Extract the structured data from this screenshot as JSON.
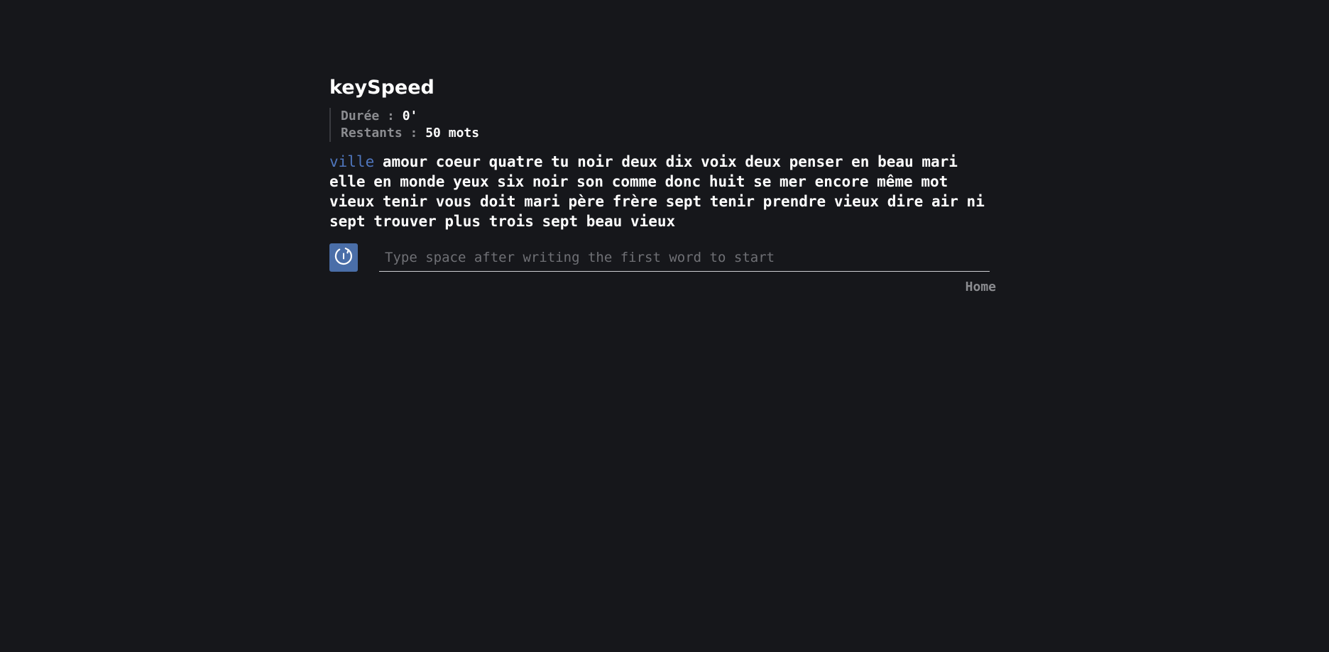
{
  "app": {
    "title": "keySpeed"
  },
  "stats": {
    "duration_label": "Durée : ",
    "duration_value": "0'",
    "remaining_label": "Restants : ",
    "remaining_value": "50 mots"
  },
  "words": [
    "ville",
    "amour",
    "coeur",
    "quatre",
    "tu",
    "noir",
    "deux",
    "dix",
    "voix",
    "deux",
    "penser",
    "en",
    "beau",
    "mari",
    "elle",
    "en",
    "monde",
    "yeux",
    "six",
    "noir",
    "son",
    "comme",
    "donc",
    "huit",
    "se",
    "mer",
    "encore",
    "même",
    "mot",
    "vieux",
    "tenir",
    "vous",
    "doit",
    "mari",
    "père",
    "frère",
    "sept",
    "tenir",
    "prendre",
    "vieux",
    "dire",
    "air",
    "ni",
    "sept",
    "trouver",
    "plus",
    "trois",
    "sept",
    "beau",
    "vieux"
  ],
  "current_word_index": 0,
  "input": {
    "value": "",
    "placeholder": "Type space after writing the first word to start"
  },
  "restart_button": {
    "icon": "restart-icon",
    "color": "#4a6ea8"
  },
  "nav": {
    "home_label": "Home"
  },
  "colors": {
    "background": "#16171b",
    "current_word": "#4f76bd",
    "label": "#8b8c90"
  }
}
